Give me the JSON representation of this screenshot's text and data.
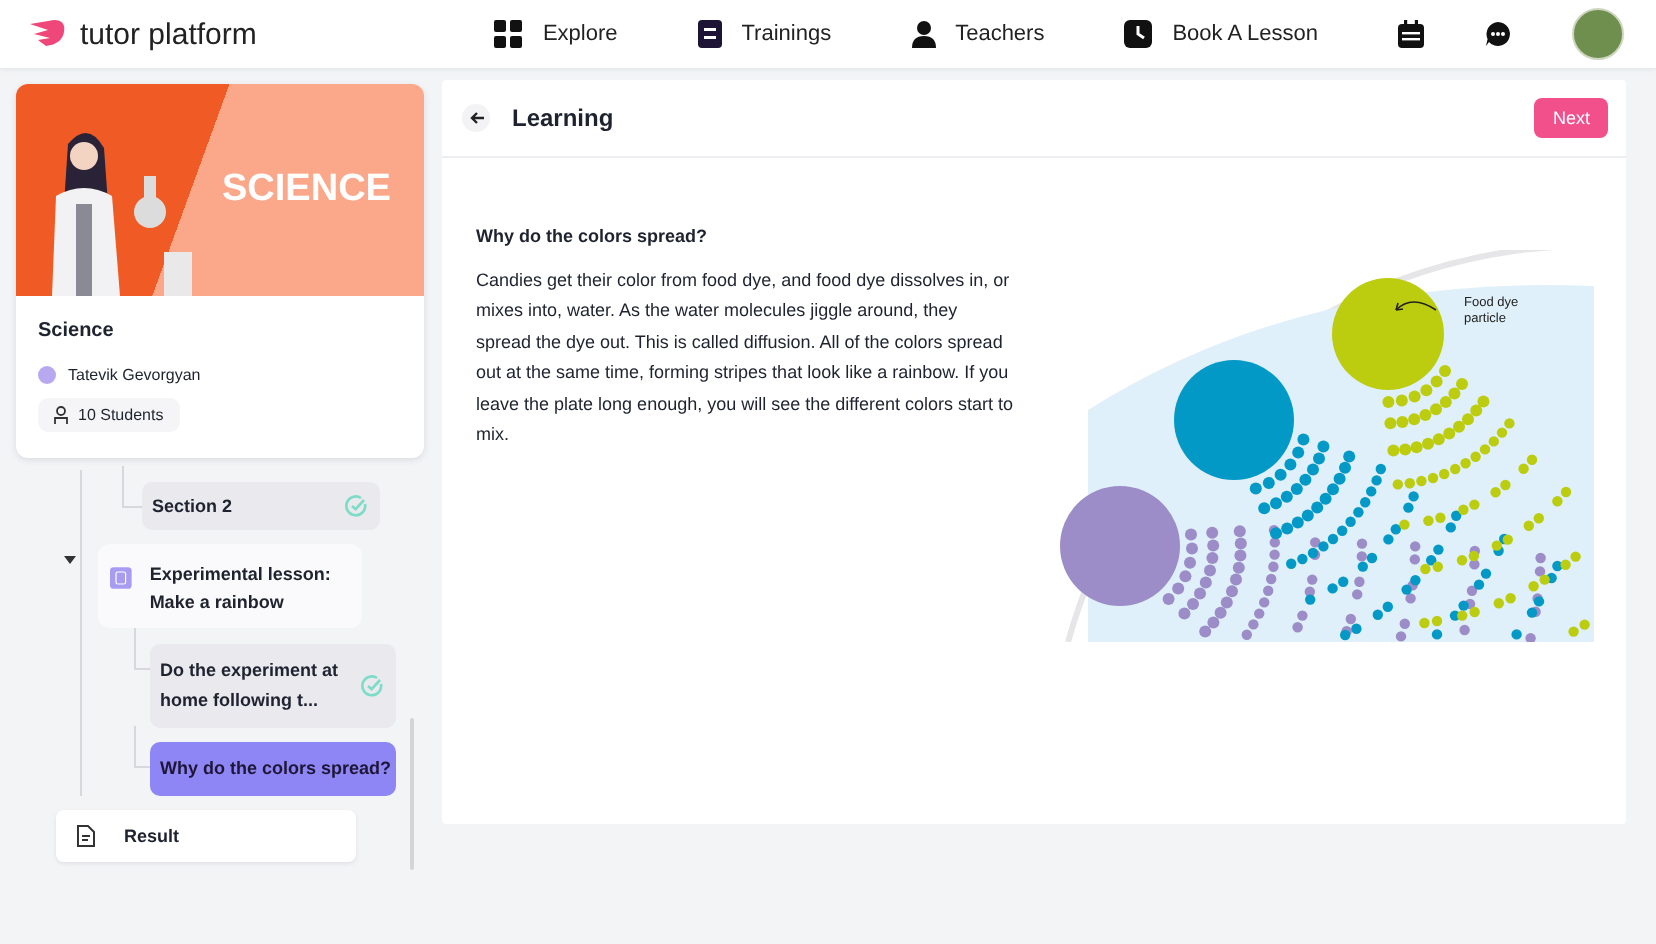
{
  "brand": {
    "name": "tutor platform"
  },
  "nav": [
    {
      "kind": "explore",
      "label": "Explore"
    },
    {
      "kind": "trainings",
      "label": "Trainings"
    },
    {
      "kind": "teachers",
      "label": "Teachers"
    },
    {
      "kind": "book",
      "label": "Book A Lesson"
    },
    {
      "kind": "calendar"
    },
    {
      "kind": "chat"
    }
  ],
  "course": {
    "banner": "SCIENCE",
    "title": "Science",
    "teacher": "Tatevik Gevorgyan",
    "students": "10 Students"
  },
  "tree": [
    {
      "kind": "section",
      "label": "Section 2",
      "completed": true,
      "selected": false
    },
    {
      "kind": "lesson",
      "label": "Experimental lesson: Make a rainbow",
      "expanded": true,
      "children": [
        {
          "kind": "step",
          "label": "Do the experiment at home following t...",
          "completed": true,
          "selected": false
        },
        {
          "kind": "step",
          "label": "Why do the colors spread?",
          "completed": false,
          "selected": true
        }
      ]
    },
    {
      "kind": "result",
      "label": "Result"
    }
  ],
  "lesson": {
    "title": "Learning",
    "next": "Next",
    "question": "Why do the colors spread?",
    "text": "Candies get their color from food dye, and food dye dissolves in, or mixes into, water. As the water molecules jiggle around, they spread the dye out. This is called diffusion. All of the colors spread out at the same time, forming stripes that look like a rainbow. If you leave the plate long enough, you will see the different colors start to mix.",
    "figure_label": "Food dye particle"
  }
}
